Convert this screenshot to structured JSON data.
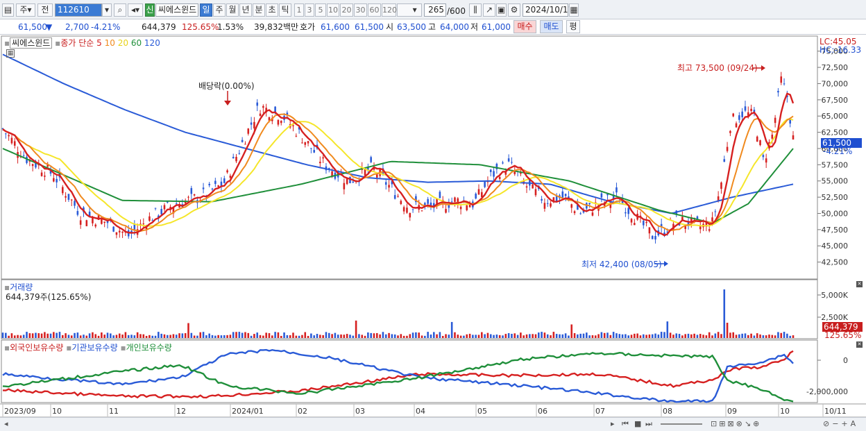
{
  "toolbar": {
    "market": "주",
    "prev": "전",
    "code": "112610",
    "name": "씨에스윈드",
    "credit_badge": "신",
    "periods": [
      "일",
      "주",
      "월",
      "년",
      "분",
      "초",
      "틱"
    ],
    "active_period": "일",
    "intervals": [
      "1",
      "3",
      "5",
      "10",
      "20",
      "30",
      "60",
      "120"
    ],
    "count": "265",
    "count_max": "/600",
    "date": "2024/10/11"
  },
  "quote": {
    "price": "61,500",
    "change_arrow": "▼",
    "change": "2,700",
    "change_pct": "-4.21%",
    "volume": "644,379",
    "volume_ratio": "125.65%",
    "turnover": "1.53%",
    "amount": "39,832백만",
    "bid_label": "호가",
    "bid1": "61,600",
    "bid2": "61,500",
    "open_label": "시",
    "open": "63,500",
    "high_label": "고",
    "high": "64,000",
    "low_label": "저",
    "low": "61,000",
    "buy": "매수",
    "sell": "매도",
    "eval": "평"
  },
  "price_panel": {
    "stock_label": "씨에스윈드",
    "ma_label": "종가 단순",
    "ma_periods": [
      "5",
      "10",
      "20",
      "60",
      "120"
    ],
    "ma_colors": [
      "#d62020",
      "#f08a1e",
      "#f5e62a",
      "#1f8f3a",
      "#2a5bd7"
    ],
    "lc": "LC:45.05",
    "hc": "HC:-16.33",
    "annotation_dividend": "배당락(0.00%)",
    "annotation_high": "최고 73,500 (09/24)",
    "annotation_low": "최저 42,400 (08/05)",
    "price_tag": "61,500",
    "price_tag_pct": "-4.21%",
    "y_ticks": [
      "75,000",
      "72,500",
      "70,000",
      "67,500",
      "65,000",
      "62,500",
      "60,000",
      "57,500",
      "55,000",
      "52,500",
      "50,000",
      "47,500",
      "45,000",
      "42,500"
    ]
  },
  "volume_panel": {
    "title": "거래량",
    "value": "644,379주(125.65%)",
    "y_ticks": [
      "5,000K",
      "2,500K"
    ],
    "tag": "644,379",
    "tag_pct": "125.65%"
  },
  "holding_panel": {
    "series": [
      "외국인보유수량",
      "기관보유수량",
      "개인보유수량"
    ],
    "colors": [
      "#d62020",
      "#2a5bd7",
      "#1f8f3a"
    ],
    "y_ticks": [
      "0",
      "-2,000,000"
    ]
  },
  "x_axis": [
    "2023/09",
    "10",
    "11",
    "12",
    "2024/01",
    "02",
    "03",
    "04",
    "05",
    "06",
    "07",
    "08",
    "09",
    "10",
    "10/11"
  ],
  "chart_data": {
    "type": "line",
    "title": "씨에스윈드",
    "x": [
      "2023/09",
      "10",
      "11",
      "12",
      "2024/01",
      "02",
      "03",
      "04",
      "05",
      "06",
      "07",
      "08",
      "09",
      "10"
    ],
    "series": [
      {
        "name": "종가",
        "values": [
          63000,
          52000,
          46500,
          52000,
          67500,
          57500,
          51000,
          58000,
          52000,
          50500,
          47000,
          48500,
          64000,
          69000
        ]
      },
      {
        "name": "120",
        "values": [
          74500,
          70000,
          66000,
          62500,
          60000,
          57500,
          55500,
          54800,
          55000,
          54500,
          51800,
          50000,
          52500,
          54500
        ]
      }
    ],
    "ylim": [
      40000,
      77000
    ],
    "high": {
      "value": 73500,
      "date": "09/24"
    },
    "low": {
      "value": 42400,
      "date": "08/05"
    }
  }
}
